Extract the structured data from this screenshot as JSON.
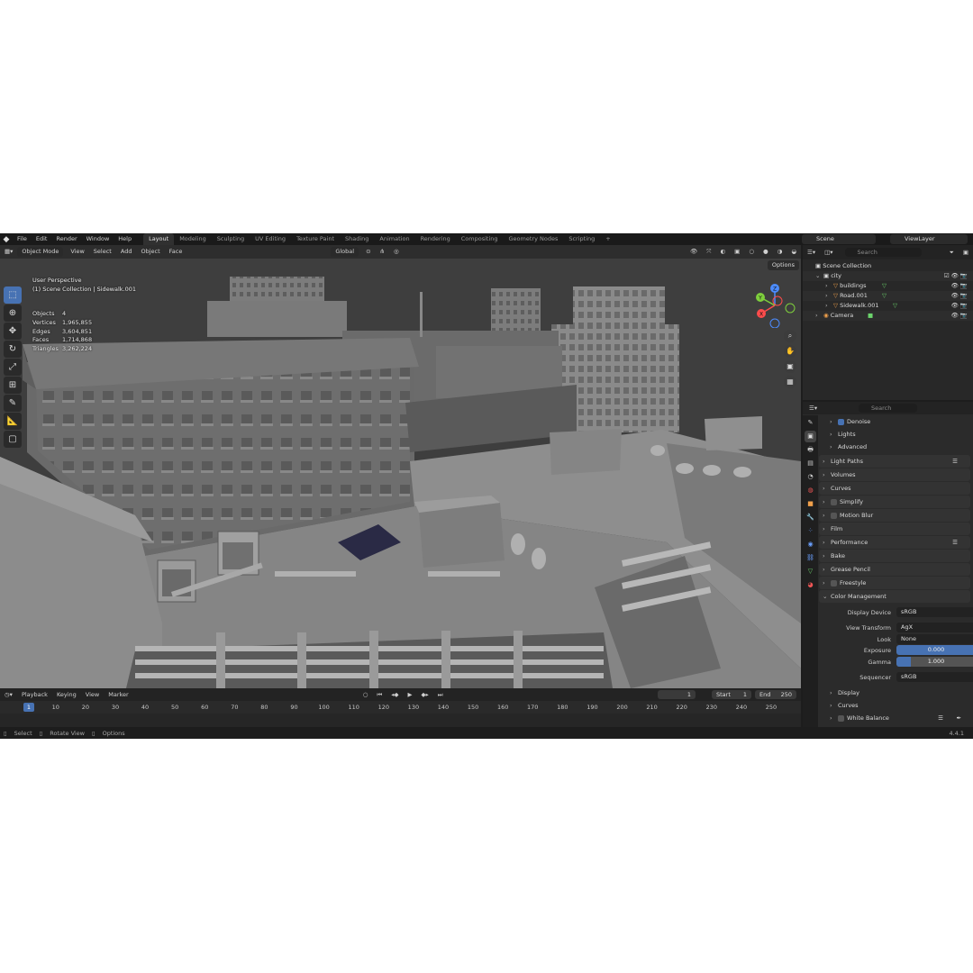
{
  "menu": [
    "File",
    "Edit",
    "Render",
    "Window",
    "Help"
  ],
  "workspaces": [
    "Layout",
    "Modeling",
    "Sculpting",
    "UV Editing",
    "Texture Paint",
    "Shading",
    "Animation",
    "Rendering",
    "Compositing",
    "Geometry Nodes",
    "Scripting"
  ],
  "active_workspace": "Layout",
  "scene": "Scene",
  "view_layer": "ViewLayer",
  "viewport": {
    "mode": "Object Mode",
    "menus": [
      "View",
      "Select",
      "Add",
      "Object",
      "Face"
    ],
    "transform_orientation": "Global",
    "options_label": "Options",
    "view_name": "User Perspective",
    "context": "(1) Scene Collection | Sidewalk.001",
    "stats": [
      {
        "label": "Objects",
        "value": "4"
      },
      {
        "label": "Vertices",
        "value": "1,965,855"
      },
      {
        "label": "Edges",
        "value": "3,604,851"
      },
      {
        "label": "Faces",
        "value": "1,714,868"
      },
      {
        "label": "Triangles",
        "value": "3,262,224"
      }
    ],
    "gizmo_axes": {
      "x": "X",
      "y": "Y",
      "z": "Z"
    }
  },
  "outliner": {
    "search_placeholder": "Search",
    "rows": [
      {
        "label": "Scene Collection",
        "indent": 0
      },
      {
        "label": "city",
        "indent": 1
      },
      {
        "label": "buildings",
        "indent": 2
      },
      {
        "label": "Road.001",
        "indent": 2
      },
      {
        "label": "Sidewalk.001",
        "indent": 2
      },
      {
        "label": "Camera",
        "indent": 1
      }
    ]
  },
  "properties": {
    "search_placeholder": "Search",
    "sections": {
      "denoise": "Denoise",
      "lights": "Lights",
      "advanced": "Advanced",
      "light_paths": "Light Paths",
      "volumes": "Volumes",
      "curves": "Curves",
      "simplify": "Simplify",
      "motion_blur": "Motion Blur",
      "film": "Film",
      "performance": "Performance",
      "bake": "Bake",
      "grease_pencil": "Grease Pencil",
      "freestyle": "Freestyle",
      "color_management": "Color Management",
      "display": "Display",
      "curves2": "Curves",
      "white_balance": "White Balance"
    },
    "color_management": {
      "display_device_label": "Display Device",
      "display_device": "sRGB",
      "view_transform_label": "View Transform",
      "view_transform": "AgX",
      "look_label": "Look",
      "look": "None",
      "exposure_label": "Exposure",
      "exposure": "0.000",
      "gamma_label": "Gamma",
      "gamma": "1.000",
      "sequencer_label": "Sequencer",
      "sequencer": "sRGB"
    }
  },
  "timeline": {
    "menus": [
      "Playback",
      "Keying",
      "View",
      "Marker"
    ],
    "current_frame": "1",
    "start_label": "Start",
    "start": "1",
    "end_label": "End",
    "end": "250",
    "ticks": [
      "1",
      "10",
      "20",
      "30",
      "40",
      "50",
      "60",
      "70",
      "80",
      "90",
      "100",
      "110",
      "120",
      "130",
      "140",
      "150",
      "160",
      "170",
      "180",
      "190",
      "200",
      "210",
      "220",
      "230",
      "240",
      "250"
    ]
  },
  "statusbar": {
    "select": "Select",
    "rotate": "Rotate View",
    "options": "Options",
    "version": "4.4.1"
  },
  "colors": {
    "accent": "#4772b3",
    "bg": "#1d1d1d",
    "viewport": "#3f3f3f"
  }
}
